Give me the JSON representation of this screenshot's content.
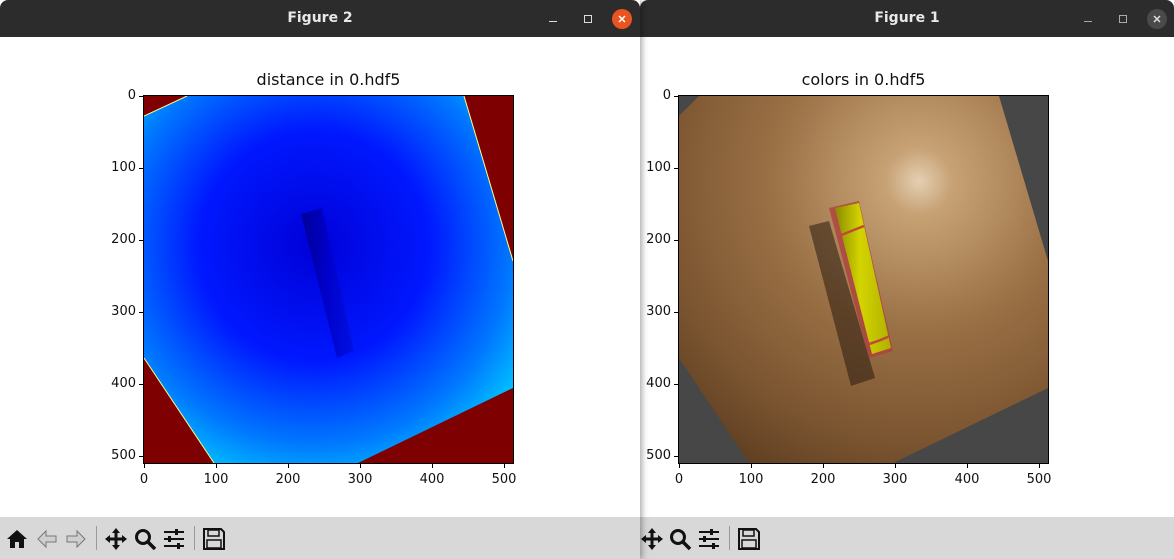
{
  "figure2": {
    "window_title": "Figure 2",
    "plot_title": "distance in 0.hdf5",
    "y_ticks": [
      "0",
      "100",
      "200",
      "300",
      "400",
      "500"
    ],
    "x_ticks": [
      "0",
      "100",
      "200",
      "300",
      "400",
      "500"
    ]
  },
  "figure1": {
    "window_title": "Figure 1",
    "plot_title": "colors in 0.hdf5",
    "y_ticks": [
      "0",
      "100",
      "200",
      "300",
      "400",
      "500"
    ],
    "x_ticks": [
      "0",
      "100",
      "200",
      "300",
      "400",
      "500"
    ]
  },
  "colors": {
    "titlebar": "#2c2c2c",
    "close_active": "#e95420",
    "toolbar": "#d8d8d8",
    "distance_background": "#7f0000",
    "colors_background": "#474747"
  },
  "toolbar_icons": [
    "home-icon",
    "back-icon",
    "forward-icon",
    "pan-icon",
    "zoom-icon",
    "configure-subplots-icon",
    "save-icon"
  ]
}
